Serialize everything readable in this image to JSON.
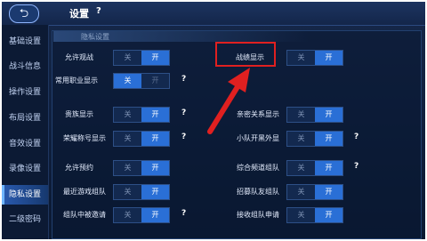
{
  "header": {
    "back_icon": "back-arrow-icon",
    "title": "设置",
    "help": "?"
  },
  "sidebar": {
    "items": [
      {
        "label": "基础设置"
      },
      {
        "label": "战斗信息"
      },
      {
        "label": "操作设置"
      },
      {
        "label": "布局设置"
      },
      {
        "label": "音效设置"
      },
      {
        "label": "录像设置"
      },
      {
        "label": "隐私设置"
      },
      {
        "label": "二级密码"
      }
    ],
    "active": "隐私设置"
  },
  "section": {
    "title": "隐私设置"
  },
  "toggle_text": {
    "off": "关",
    "on": "开"
  },
  "settings": [
    {
      "label": "允许观战",
      "value": "开"
    },
    {
      "label": "常用职业显示",
      "value": "关"
    },
    {
      "label": "贵族显示",
      "value": "开"
    },
    {
      "label": "荣耀称号显示",
      "value": "开"
    },
    {
      "label": "允许预约",
      "value": "开"
    },
    {
      "label": "最近游戏组队",
      "value": "开"
    },
    {
      "label": "组队中被邀请",
      "value": "开"
    },
    {
      "label": "战绩显示",
      "value": "开"
    },
    {
      "label": "亲密关系显示",
      "value": "开"
    },
    {
      "label": "小队开黑外显",
      "value": "开"
    },
    {
      "label": "综合频道组队",
      "value": "开"
    },
    {
      "label": "招募队友组队",
      "value": "开"
    },
    {
      "label": "接收组队申请",
      "value": "开"
    }
  ],
  "help_mark": "?",
  "annotation": {
    "highlight_color": "#e02020",
    "arrow_color": "#e02020"
  },
  "colors": {
    "accent": "#2a6fd6",
    "background": "#0f1f3d"
  }
}
